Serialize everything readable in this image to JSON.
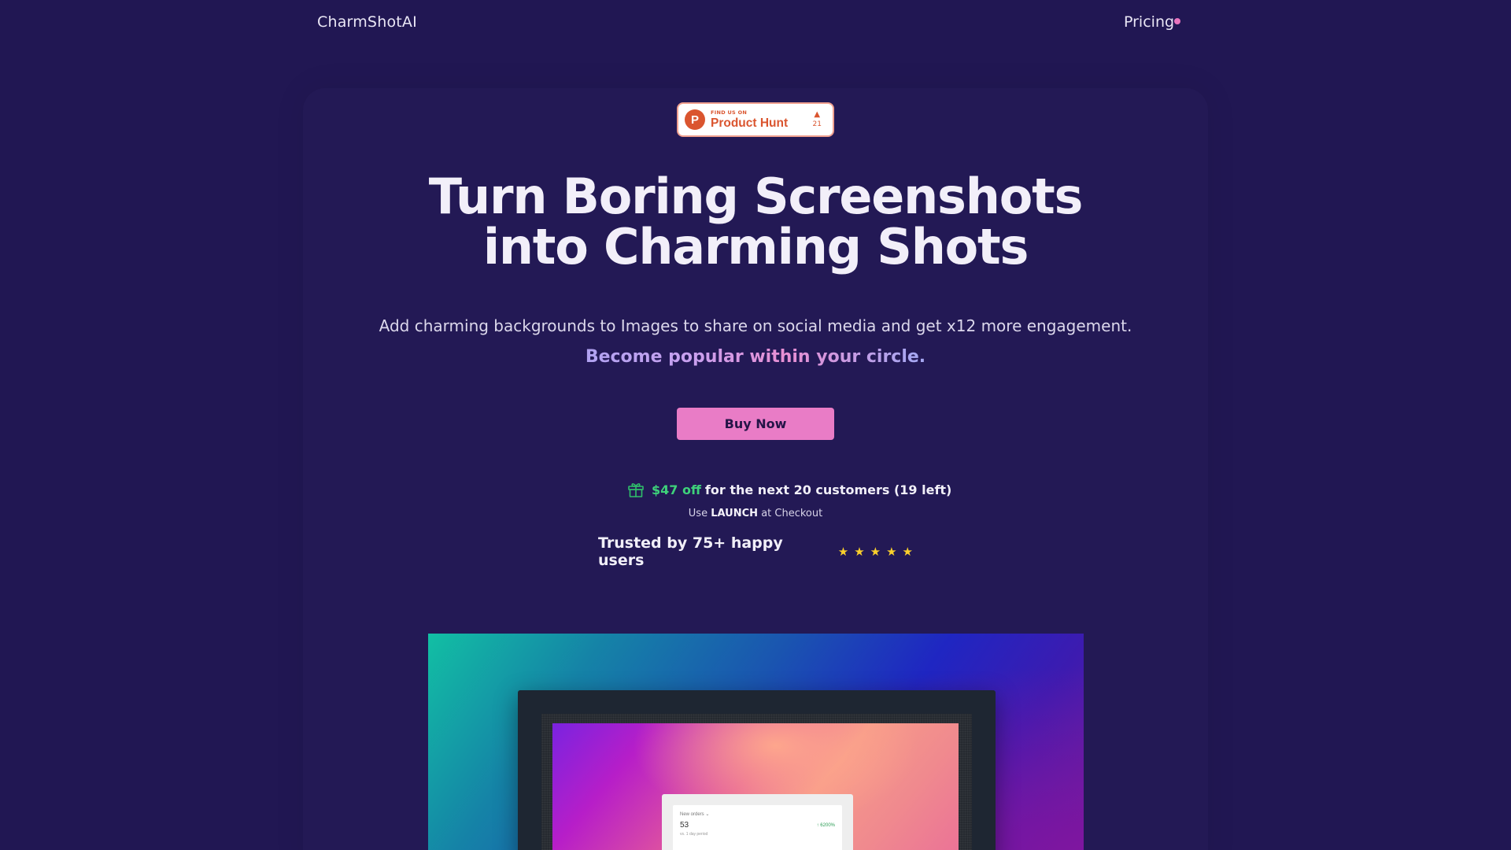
{
  "nav": {
    "brand": "CharmShotAI",
    "pricing_label": "Pricing"
  },
  "product_hunt": {
    "small_label": "FIND US ON",
    "name": "Product Hunt",
    "votes": "21",
    "arrow": "▲"
  },
  "hero": {
    "headline_line1": "Turn Boring Screenshots",
    "headline_line2": "into Charming Shots",
    "subtitle": "Add charming backgrounds to Images to share on social media and get x12 more engagement.",
    "tagline": "Become popular within your circle.",
    "buy_label": "Buy Now"
  },
  "offer": {
    "amount": "$47 off",
    "rest": "for the next 20 customers (19 left)",
    "coupon_prefix": "Use",
    "coupon_code": "LAUNCH",
    "coupon_suffix": "at Checkout",
    "trusted": "Trusted by 75+ happy users",
    "rating": 5
  },
  "preview": {
    "card_title": "New orders ⌄",
    "card_value": "53",
    "card_change": "↑ 6200%",
    "card_sub": "vs. 1 day period"
  },
  "colors": {
    "background": "#211753",
    "accent_pink": "#e97cc6",
    "discount_green": "#3ed17a",
    "star_yellow": "#fad02c",
    "product_hunt_orange": "#da552f"
  },
  "icons": [
    "gift-icon",
    "star-icon",
    "product-hunt-logo-icon",
    "upvote-arrow-icon"
  ]
}
